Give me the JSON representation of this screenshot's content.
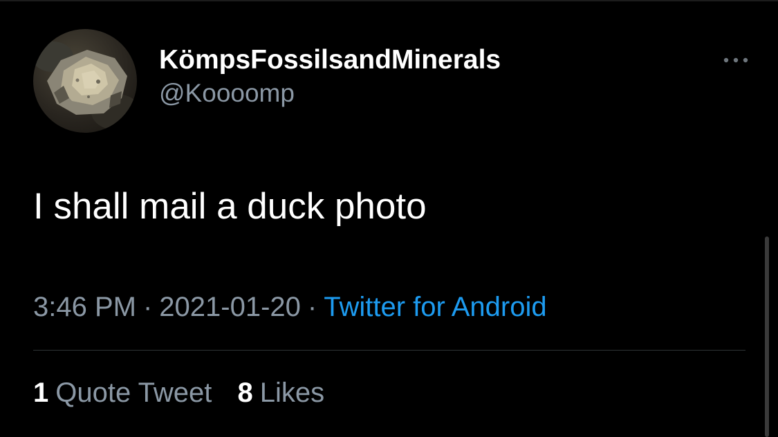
{
  "author": {
    "display_name": "KömpsFossilsandMinerals",
    "handle": "@Koooomp",
    "avatar_icon": "rock-mineral-photo"
  },
  "tweet": {
    "text": "I shall mail a duck photo"
  },
  "meta": {
    "time": "3:46 PM",
    "separator": "·",
    "date": "2021-01-20",
    "source": "Twitter for Android"
  },
  "stats": {
    "quote_tweets_count": "1",
    "quote_tweets_label": "Quote Tweet",
    "likes_count": "8",
    "likes_label": "Likes"
  },
  "colors": {
    "background": "#000000",
    "primary_text": "#ffffff",
    "secondary_text": "#8b98a5",
    "link": "#1d9bf0",
    "divider": "#2f3336"
  }
}
